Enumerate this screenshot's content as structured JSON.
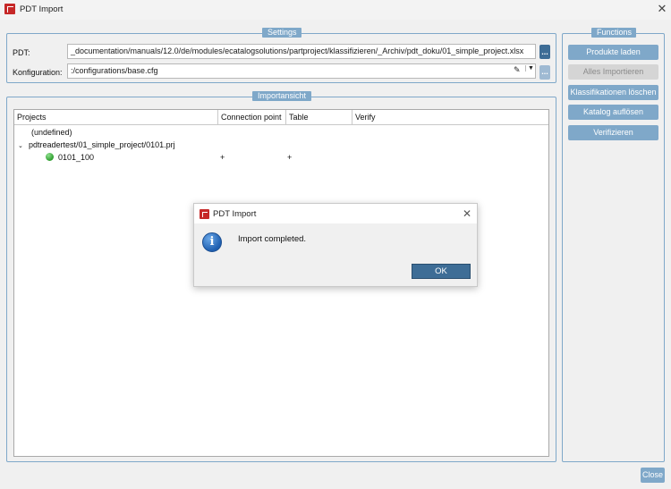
{
  "window": {
    "title": "PDT Import"
  },
  "settings": {
    "title": "Settings",
    "pdt_label": "PDT:",
    "pdt_value": "_documentation/manuals/12.0/de/modules/ecatalogsolutions/partproject/klassifizieren/_Archiv/pdt_doku/01_simple_project.xlsx",
    "pdt_browse": "...",
    "konfig_label": "Konfiguration:",
    "konfig_value": ":/configurations/base.cfg",
    "konfig_browse": "..."
  },
  "functions": {
    "title": "Functions",
    "buttons": [
      {
        "label": "Produkte laden",
        "enabled": true
      },
      {
        "label": "Alles Importieren",
        "enabled": false
      },
      {
        "label": "Klassifikationen löschen",
        "enabled": true
      },
      {
        "label": "Katalog auflösen",
        "enabled": true
      },
      {
        "label": "Verifizieren",
        "enabled": true
      }
    ]
  },
  "importansicht": {
    "title": "Importansicht",
    "columns": [
      "Projects",
      "Connection point",
      "Table",
      "Verify"
    ],
    "rows": [
      {
        "project": "(undefined)",
        "connection_point": "",
        "table": "",
        "verify": ""
      },
      {
        "project": "pdtreadertest/01_simple_project/0101.prj",
        "connection_point": "",
        "table": "",
        "verify": ""
      },
      {
        "project": "0101_100",
        "connection_point": "+",
        "table": "+",
        "verify": ""
      }
    ]
  },
  "dialog": {
    "title": "PDT Import",
    "message": "Import completed.",
    "ok_label": "OK"
  },
  "footer": {
    "close_label": "Close"
  },
  "colors": {
    "accent": "#7fa8c9",
    "primary_button": "#3e6d96",
    "status_ok": "#2e9e2e"
  }
}
